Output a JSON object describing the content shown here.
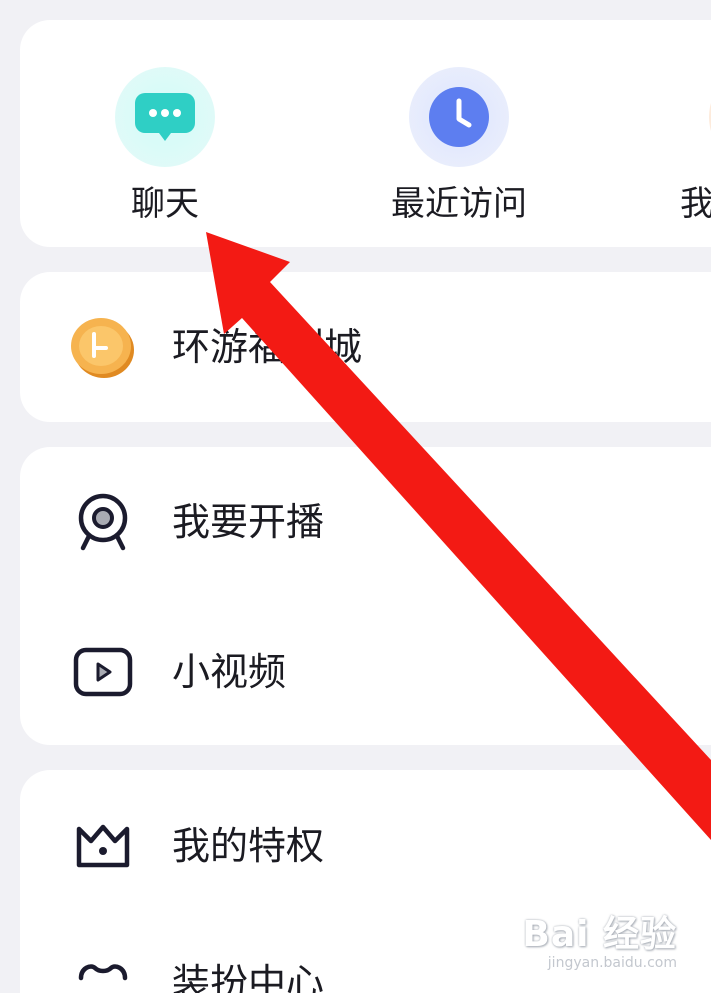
{
  "quick_entries": [
    {
      "label": "聊天",
      "icon": "chat-bubble-icon"
    },
    {
      "label": "最近访问",
      "icon": "clock-icon"
    },
    {
      "label": "我",
      "icon": "partial-icon"
    }
  ],
  "welfare": {
    "label": "环游福利城",
    "icon": "gold-coin-icon"
  },
  "live_section": [
    {
      "label": "我要开播",
      "icon": "webcam-icon"
    },
    {
      "label": "小视频",
      "icon": "video-play-icon"
    }
  ],
  "privilege_section": [
    {
      "label": "我的特权",
      "icon": "crown-icon"
    },
    {
      "label": "装扮中心",
      "icon": "outfit-icon"
    }
  ],
  "watermark": {
    "main": "Bai 经验",
    "sub": "jingyan.baidu.com"
  },
  "colors": {
    "arrow": "#f31a14",
    "chat_icon": "#2fd1c6",
    "clock_icon": "#5f7ff0",
    "coin": "#f2b24b"
  }
}
